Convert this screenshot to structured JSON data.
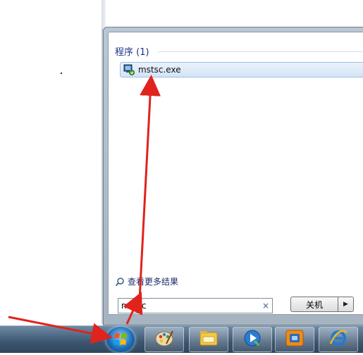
{
  "start_menu": {
    "programs_section_title": "程序 (1)",
    "results": [
      {
        "label": "mstsc.exe",
        "icon": "remote-desktop-icon"
      }
    ],
    "see_more_label": "查看更多结果",
    "search": {
      "value": "mstsc",
      "clear_symbol": "×"
    },
    "shutdown_label": "关机",
    "shutdown_arrow": "▶"
  },
  "taskbar": {
    "items": [
      {
        "icon": "windows-start-orb-icon"
      },
      {
        "icon": "paint-palette-icon"
      },
      {
        "icon": "file-explorer-icon"
      },
      {
        "icon": "media-player-icon"
      },
      {
        "icon": "virtual-machine-icon"
      },
      {
        "icon": "internet-explorer-icon"
      }
    ]
  },
  "annotations": {
    "arrow_color": "#e0231c"
  }
}
